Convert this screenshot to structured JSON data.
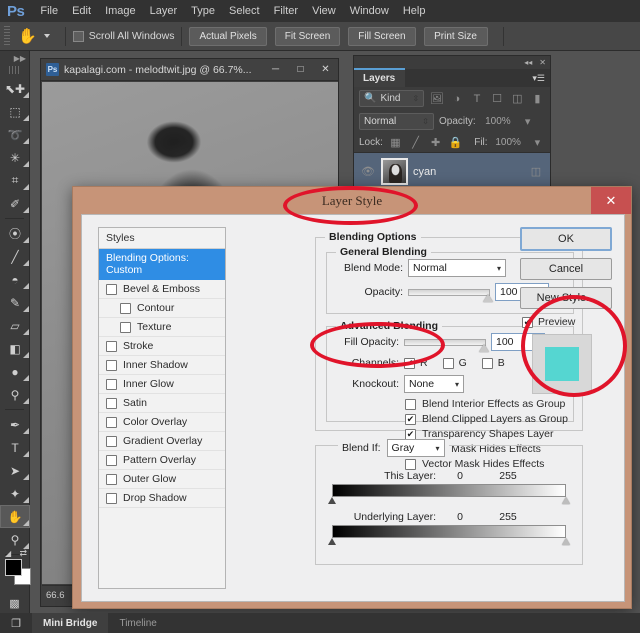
{
  "app": {
    "logo": "Ps",
    "menus": [
      "File",
      "Edit",
      "Image",
      "Layer",
      "Type",
      "Select",
      "Filter",
      "View",
      "Window",
      "Help"
    ]
  },
  "options_bar": {
    "tool_icon": "hand-tool",
    "scroll_all_windows": {
      "label": "Scroll All Windows",
      "checked": false
    },
    "buttons": [
      "Actual Pixels",
      "Fit Screen",
      "Fill Screen",
      "Print Size"
    ]
  },
  "toolbox": {
    "tools": [
      {
        "name": "move-tool",
        "glyph": "⬉",
        "active": false
      },
      {
        "name": "marquee-tool",
        "glyph": "⬚",
        "active": false
      },
      {
        "name": "lasso-tool",
        "glyph": "➰",
        "active": false
      },
      {
        "name": "quick-selection-tool",
        "glyph": "✳",
        "active": false
      },
      {
        "name": "crop-tool",
        "glyph": "⌗",
        "active": false
      },
      {
        "name": "eyedropper-tool",
        "glyph": "✐",
        "active": false
      },
      {
        "name": "spot-healing-brush-tool",
        "glyph": "⊕",
        "active": false
      },
      {
        "name": "brush-tool",
        "glyph": "╱",
        "active": false
      },
      {
        "name": "clone-stamp-tool",
        "glyph": "⚓",
        "active": false
      },
      {
        "name": "history-brush-tool",
        "glyph": "✎",
        "active": false
      },
      {
        "name": "eraser-tool",
        "glyph": "▱",
        "active": false
      },
      {
        "name": "gradient-tool",
        "glyph": "◧",
        "active": false
      },
      {
        "name": "blur-tool",
        "glyph": "●",
        "active": false
      },
      {
        "name": "dodge-tool",
        "glyph": "⚲",
        "active": false
      },
      {
        "name": "pen-tool",
        "glyph": "✒",
        "active": false
      },
      {
        "name": "type-tool",
        "glyph": "T",
        "active": false
      },
      {
        "name": "path-selection-tool",
        "glyph": "➤",
        "active": false
      },
      {
        "name": "custom-shape-tool",
        "glyph": "★",
        "active": false
      },
      {
        "name": "hand-tool",
        "glyph": "✋",
        "active": true
      },
      {
        "name": "zoom-tool",
        "glyph": "⚲",
        "active": false
      }
    ],
    "foreground_color": "#000000",
    "background_color": "#ffffff"
  },
  "document": {
    "title": "kapalagi.com - melodtwit.jpg @ 66.7%...",
    "badge": "Ps",
    "window_buttons": [
      "minimize",
      "maximize",
      "close"
    ],
    "zoom_status": "66.6"
  },
  "layers_panel": {
    "tab": "Layers",
    "filter_kind": "Kind",
    "blend_mode": "Normal",
    "opacity_label": "Opacity:",
    "opacity_value": "100%",
    "lock_label": "Lock:",
    "fill_label": "Fil:",
    "fill_value": "100%",
    "layers": [
      {
        "name": "cyan",
        "visible": true,
        "selected": true
      }
    ]
  },
  "dialog": {
    "title": "Layer Style",
    "close_glyph": "✕",
    "styles_header": "Styles",
    "styles": [
      {
        "label": "Blending Options: Custom",
        "selected": true,
        "checkbox": false,
        "indent": false
      },
      {
        "label": "Bevel & Emboss",
        "selected": false,
        "checkbox": true,
        "checked": false,
        "indent": false
      },
      {
        "label": "Contour",
        "selected": false,
        "checkbox": true,
        "checked": false,
        "indent": true
      },
      {
        "label": "Texture",
        "selected": false,
        "checkbox": true,
        "checked": false,
        "indent": true
      },
      {
        "label": "Stroke",
        "selected": false,
        "checkbox": true,
        "checked": false,
        "indent": false
      },
      {
        "label": "Inner Shadow",
        "selected": false,
        "checkbox": true,
        "checked": false,
        "indent": false
      },
      {
        "label": "Inner Glow",
        "selected": false,
        "checkbox": true,
        "checked": false,
        "indent": false
      },
      {
        "label": "Satin",
        "selected": false,
        "checkbox": true,
        "checked": false,
        "indent": false
      },
      {
        "label": "Color Overlay",
        "selected": false,
        "checkbox": true,
        "checked": false,
        "indent": false
      },
      {
        "label": "Gradient Overlay",
        "selected": false,
        "checkbox": true,
        "checked": false,
        "indent": false
      },
      {
        "label": "Pattern Overlay",
        "selected": false,
        "checkbox": true,
        "checked": false,
        "indent": false
      },
      {
        "label": "Outer Glow",
        "selected": false,
        "checkbox": true,
        "checked": false,
        "indent": false
      },
      {
        "label": "Drop Shadow",
        "selected": false,
        "checkbox": true,
        "checked": false,
        "indent": false
      }
    ],
    "blending_options_legend": "Blending Options",
    "general_blending": {
      "legend": "General Blending",
      "blend_mode_label": "Blend Mode:",
      "blend_mode_value": "Normal",
      "opacity_label": "Opacity:",
      "opacity_value": "100",
      "percent": "%"
    },
    "advanced_blending": {
      "legend": "Advanced Blending",
      "fill_opacity_label": "Fill Opacity:",
      "fill_opacity_value": "100",
      "percent": "%",
      "channels_label": "Channels:",
      "channels": [
        {
          "label": "R",
          "checked": true
        },
        {
          "label": "G",
          "checked": false
        },
        {
          "label": "B",
          "checked": false
        }
      ],
      "knockout_label": "Knockout:",
      "knockout_value": "None",
      "checkboxes": [
        {
          "label": "Blend Interior Effects as Group",
          "checked": false
        },
        {
          "label": "Blend Clipped Layers as Group",
          "checked": true
        },
        {
          "label": "Transparency Shapes Layer",
          "checked": true
        },
        {
          "label": "Layer Mask Hides Effects",
          "checked": false
        },
        {
          "label": "Vector Mask Hides Effects",
          "checked": false
        }
      ]
    },
    "blend_if": {
      "label": "Blend If:",
      "channel_value": "Gray",
      "this_layer": {
        "label": "This Layer:",
        "min": "0",
        "max": "255"
      },
      "underlying_layer": {
        "label": "Underlying Layer:",
        "min": "0",
        "max": "255"
      }
    },
    "buttons": [
      {
        "label": "OK",
        "primary": true
      },
      {
        "label": "Cancel",
        "primary": false
      },
      {
        "label": "New Style...",
        "primary": false
      }
    ],
    "preview": {
      "label": "Preview",
      "checked": true,
      "swatch_color": "#55D6D1"
    }
  },
  "annotations": [
    {
      "name": "annotation-layer-style-title",
      "color": "#e0142a"
    },
    {
      "name": "annotation-channels",
      "color": "#e0142a"
    },
    {
      "name": "annotation-preview",
      "color": "#e0142a"
    }
  ],
  "bottom_bar": {
    "tabs": [
      {
        "label": "Mini Bridge",
        "active": true
      },
      {
        "label": "Timeline",
        "active": false
      }
    ]
  }
}
